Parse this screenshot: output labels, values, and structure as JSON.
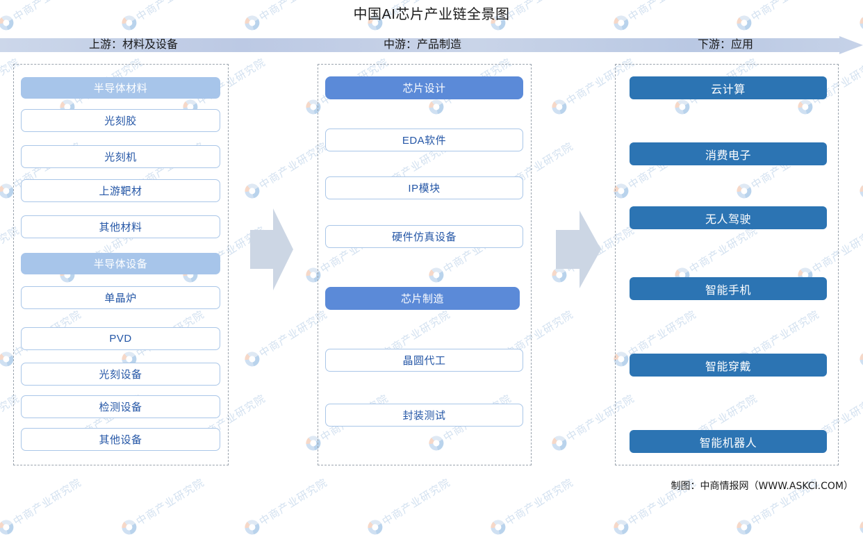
{
  "title": "中国AI芯片产业链全景图",
  "stages": [
    {
      "key": "upstream",
      "label": "上游：材料及设备"
    },
    {
      "key": "midstream",
      "label": "中游：产品制造"
    },
    {
      "key": "downstream",
      "label": "下游：应用"
    }
  ],
  "upstream": {
    "groups": [
      {
        "header": "半导体材料",
        "items": [
          "光刻胶",
          "光刻机",
          "上游靶材",
          "其他材料"
        ]
      },
      {
        "header": "半导体设备",
        "items": [
          "单晶炉",
          "PVD",
          "光刻设备",
          "检测设备",
          "其他设备"
        ]
      }
    ]
  },
  "midstream": {
    "groups": [
      {
        "header": "芯片设计",
        "items": [
          "EDA软件",
          "IP模块",
          "硬件仿真设备"
        ]
      },
      {
        "header": "芯片制造",
        "items": [
          "晶圆代工",
          "封装测试"
        ]
      }
    ]
  },
  "downstream": {
    "items": [
      "云计算",
      "消费电子",
      "无人驾驶",
      "智能手机",
      "智能穿戴",
      "智能机器人"
    ]
  },
  "footer": "制图：中商情报网（WWW.ASKCI.COM）",
  "watermark": {
    "text": "中商产业研究院",
    "logo_icon": "circle-logo-icon"
  },
  "colors": {
    "header_light_blue": "#a7c5ea",
    "header_mid_blue": "#5b8ad8",
    "downstream_blue": "#2c74b3",
    "item_border": "#a9c6e8",
    "item_text": "#2456a6",
    "stage_bar": "#c3cfe6",
    "connector_arrow": "#ccd6e4",
    "column_dash": "#9aa3ad"
  }
}
